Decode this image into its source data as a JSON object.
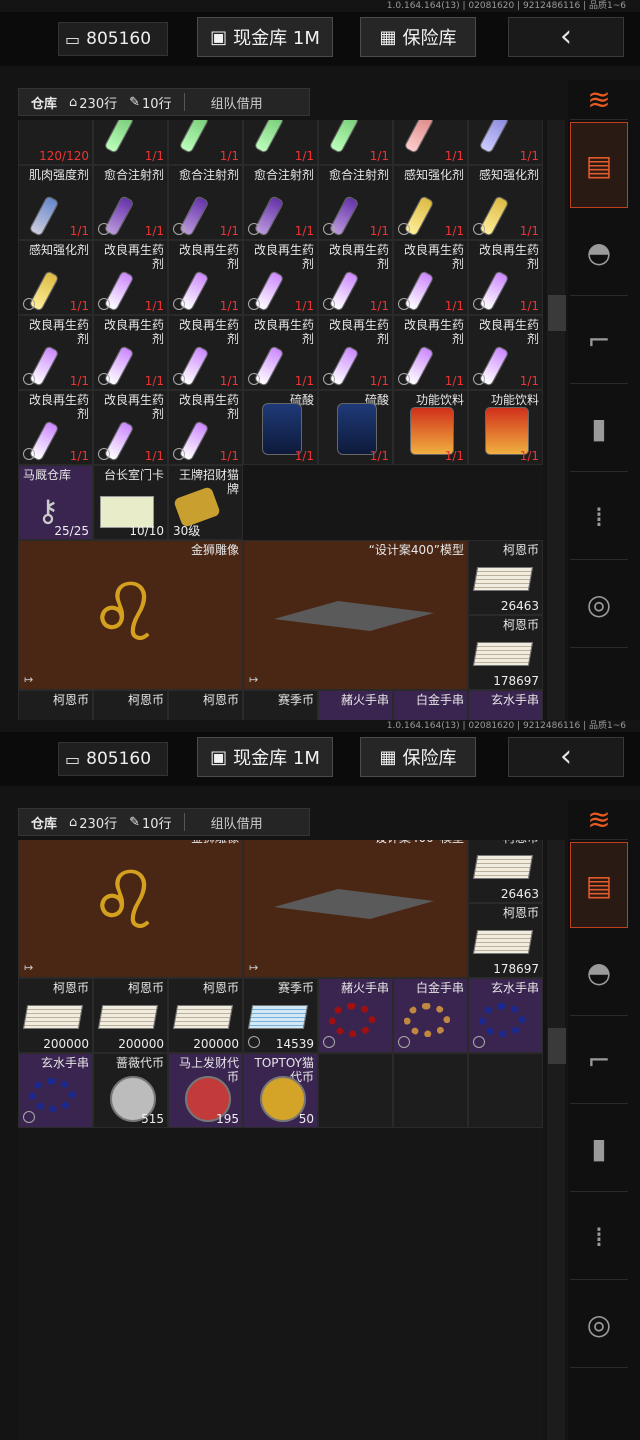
{
  "version": "1.0.164.164(13) | 02081620 | 9212486116 | 品质1~6",
  "currency": {
    "amount": "805160"
  },
  "buttons": {
    "cash": "现金库 1M",
    "safe": "保险库"
  },
  "tabs": {
    "warehouse": "仓库",
    "rows_home": "230行",
    "rows_other": "10行",
    "borrow": "组队借用"
  },
  "accent": "#e25a2c",
  "items": {
    "muscle": "肌肉强度剂",
    "heal": "愈合注射剂",
    "perception": "感知强化剂",
    "regen": "改良再生药剂",
    "sulfuric": "硫酸",
    "drink": "功能饮料",
    "stable_key": "马厩仓库",
    "stable_count": "25/25",
    "taichang": "台长室门卡",
    "taichang_count": "10/10",
    "cat": "王牌招财猫牌",
    "cat_level": "30级",
    "lion": "金狮雕像",
    "model": "“设计案400”模型",
    "koin": "柯恩币",
    "koin_a": "26463",
    "koin_b": "178697",
    "koin_c": "200000",
    "season": "赛季币",
    "season_count": "14539",
    "red_beads": "赭火手串",
    "platinum_beads": "白金手串",
    "xuanshui_beads": "玄水手串",
    "rose_token": "蔷薇代币",
    "rose_count": "515",
    "horse_token": "马上发财代币",
    "horse_count": "195",
    "toptoy": "TOPTOY猫代币",
    "toptoy_count": "50",
    "count_120": "120/120",
    "count_1": "1/1"
  }
}
